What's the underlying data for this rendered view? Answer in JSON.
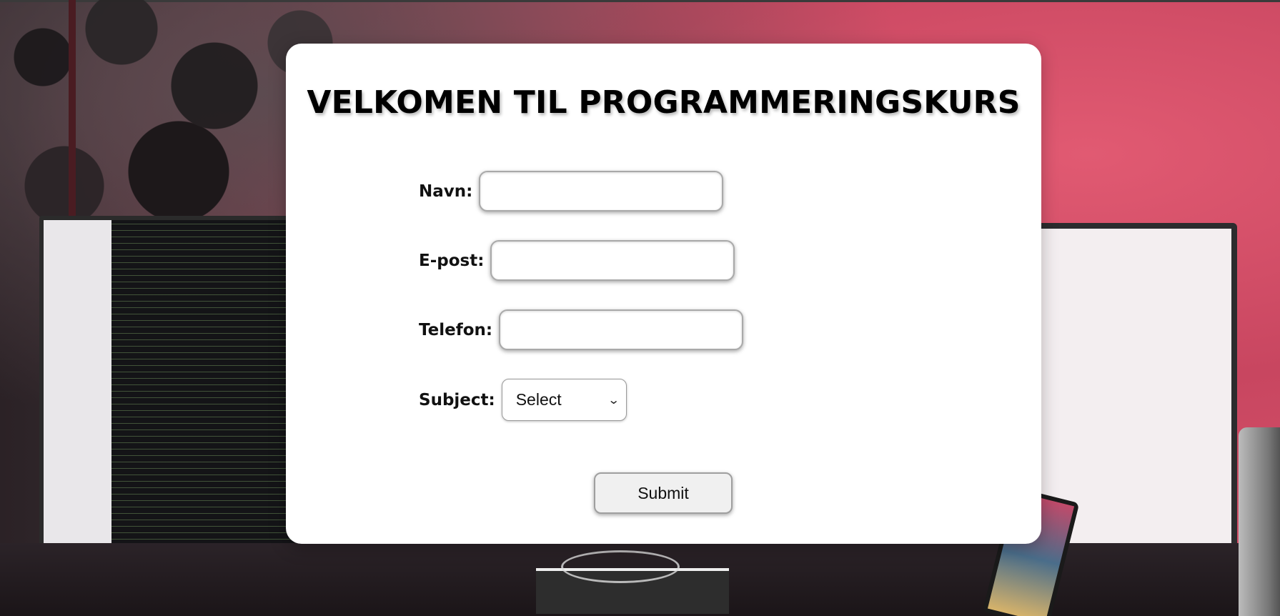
{
  "page": {
    "title": "VELKOMEN TIL PROGRAMMERINGSKURS"
  },
  "form": {
    "fields": [
      {
        "label": "Navn:",
        "value": "",
        "placeholder": ""
      },
      {
        "label": "E-post:",
        "value": "",
        "placeholder": ""
      },
      {
        "label": "Telefon:",
        "value": "",
        "placeholder": ""
      }
    ],
    "subject": {
      "label": "Subject:",
      "selected": "Select"
    },
    "submit_label": "Submit"
  },
  "colors": {
    "card_background": "#ffffff",
    "button_background": "#f0f0f0"
  }
}
